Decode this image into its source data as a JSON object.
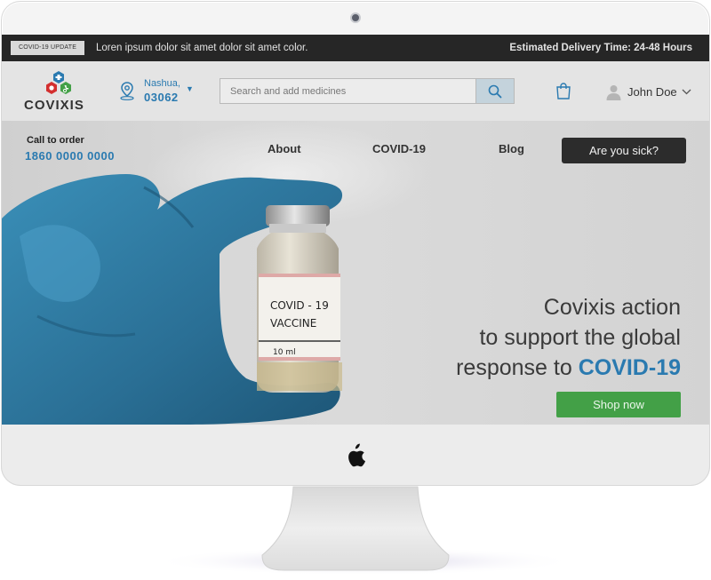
{
  "topbar": {
    "tag": "COVID-19 UPDATE",
    "message": "Loren ipsum dolor sit amet dolor sit amet color.",
    "delivery": "Estimated Delivery Time: 24-48 Hours"
  },
  "header": {
    "logo_text": "COVIXIS",
    "location": {
      "city": "Nashua,",
      "zip": "03062",
      "icon": "map-pin-icon"
    },
    "search": {
      "placeholder": "Search and add medicines",
      "icon": "search-icon"
    },
    "cart_icon": "shopping-bag-icon",
    "user": {
      "name": "John Doe",
      "icon": "avatar-icon"
    }
  },
  "nav": {
    "call_label": "Call to order",
    "call_number": "1860 0000 0000",
    "links": [
      "About",
      "COVID-19",
      "Blog"
    ],
    "cta": "Are you sick?"
  },
  "hero": {
    "vial_line1": "COVID - 19",
    "vial_line2": "VACCINE",
    "vial_volume": "10 ml",
    "headline_line1": "Covixis action",
    "headline_line2": "to support the global",
    "headline_line3_prefix": "response to ",
    "headline_line3_accent": "COVID-19",
    "cta": "Shop now"
  },
  "colors": {
    "accent_blue": "#2a7ab0",
    "cta_green": "#43a047",
    "dark": "#262626",
    "glove_blue": "#2e7fa8"
  }
}
